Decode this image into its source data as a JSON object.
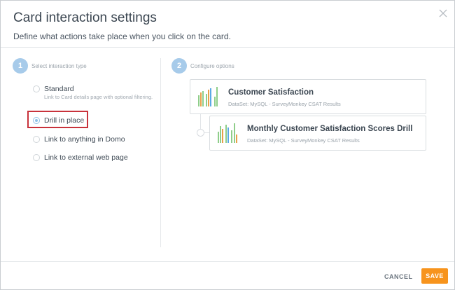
{
  "dialog": {
    "title": "Card interaction settings",
    "subtitle": "Define what actions take place when you click on the card.",
    "close_icon": "close-icon"
  },
  "step1": {
    "number": "1",
    "label": "Select interaction type",
    "options": [
      {
        "label": "Standard",
        "description": "Link to Card details page with optional filtering.",
        "checked": false
      },
      {
        "label": "Drill in place",
        "description": "",
        "checked": true
      },
      {
        "label": "Link to anything in Domo",
        "description": "",
        "checked": false
      },
      {
        "label": "Link to external web page",
        "description": "",
        "checked": false
      }
    ]
  },
  "step2": {
    "number": "2",
    "label": "Configure options",
    "cards": [
      {
        "title": "Customer Satisfaction",
        "dataset": "DataSet: MySQL - SurveyMonkey CSAT Results",
        "icon": "bar-chart-icon"
      },
      {
        "title": "Monthly Customer Satisfaction Scores Drill",
        "dataset": "DataSet: MySQL - SurveyMonkey CSAT Results",
        "icon": "bar-chart-icon"
      }
    ]
  },
  "footer": {
    "cancel_label": "CANCEL",
    "save_label": "SAVE"
  },
  "colors": {
    "accent": "#f7941d",
    "step_badge": "#a7cbea",
    "highlight": "#c8323b"
  }
}
